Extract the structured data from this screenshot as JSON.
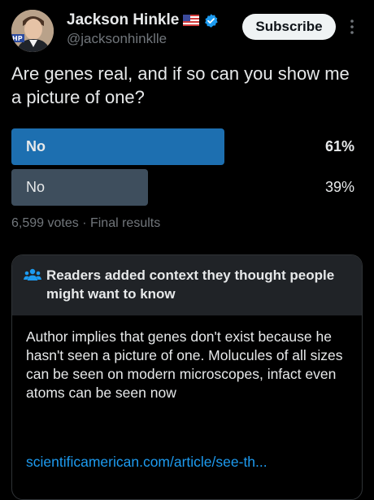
{
  "author": {
    "name": "Jackson Hinkle",
    "handle": "@jacksonhinklle",
    "avatar_badge": "HP"
  },
  "subscribe_label": "Subscribe",
  "question": "Are genes real, and if so can you show me a picture of one?",
  "poll": {
    "options": [
      {
        "label": "No",
        "percent_text": "61%",
        "percent": 61,
        "winner": true,
        "color": "#1d6fb0"
      },
      {
        "label": "No",
        "percent_text": "39%",
        "percent": 39,
        "winner": false,
        "color": "#3e4e5d"
      }
    ],
    "votes_text": "6,599 votes",
    "separator": "·",
    "status_text": "Final results"
  },
  "community_note": {
    "title": "Readers added context they thought people might want to know",
    "body": "Author implies that genes don't exist because he hasn't seen a picture of one. Molucules of all sizes can be seen on modern microscopes, infact even atoms can be seen now",
    "link": "scientificamerican.com/article/see-th..."
  },
  "colors": {
    "background": "#000000",
    "text": "#e7e9ea",
    "secondary": "#71767b",
    "link": "#1d9bf0",
    "verified": "#1d9bf0"
  },
  "icons": [
    "us-flag-icon",
    "verified-badge-icon",
    "more-icon",
    "people-icon"
  ]
}
